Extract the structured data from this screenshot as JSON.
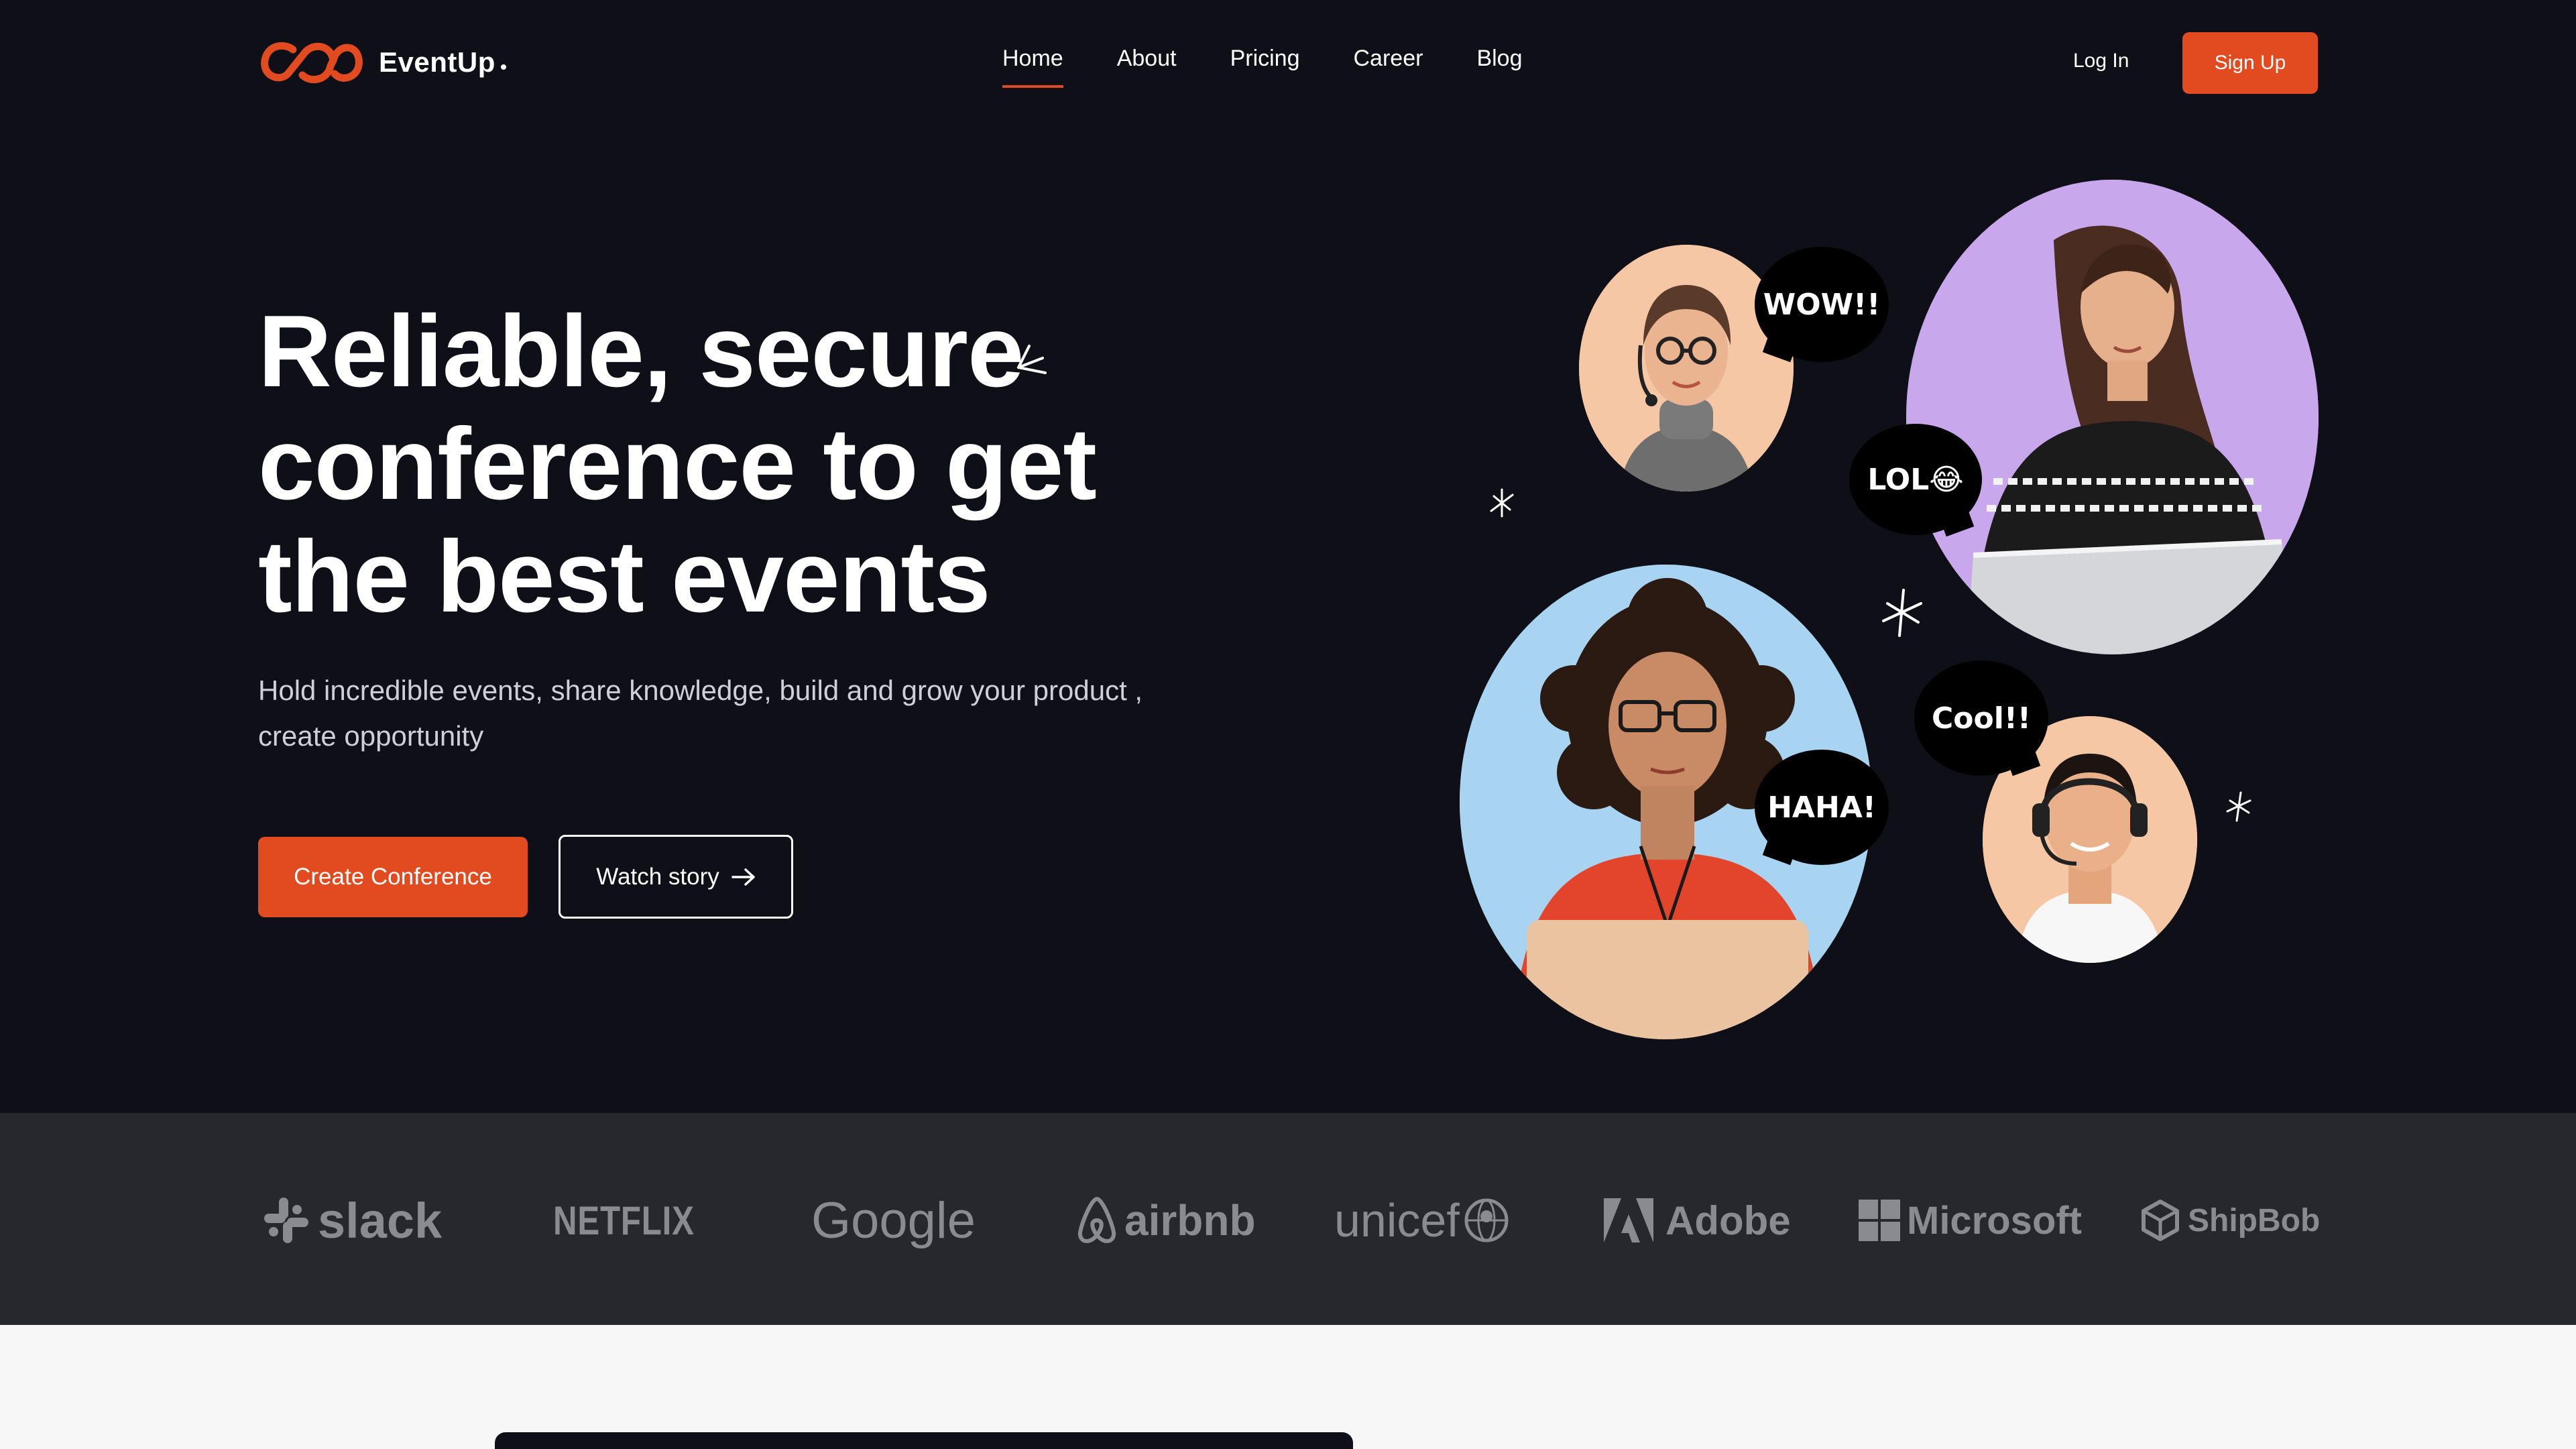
{
  "header": {
    "brand": "EventUp",
    "nav": [
      {
        "label": "Home",
        "active": true
      },
      {
        "label": "About"
      },
      {
        "label": "Pricing"
      },
      {
        "label": "Career"
      },
      {
        "label": "Blog"
      }
    ],
    "login_label": "Log In",
    "signup_label": "Sign Up"
  },
  "hero": {
    "title_line1": "Reliable, secure",
    "title_line2": "conference to get",
    "title_line3": "the best events",
    "subtitle_line1": "Hold incredible events, share knowledge, build and grow your product ,",
    "subtitle_line2": "create opportunity",
    "primary_button": "Create Conference",
    "secondary_button": "Watch story"
  },
  "bubbles": {
    "wow": "WOW!!",
    "lol": "LOL😂",
    "haha": "HAHA!",
    "cool": "Cool!!"
  },
  "brands": [
    "slack",
    "NETFLIX",
    "Google",
    "airbnb",
    "unicef",
    "Adobe",
    "Microsoft",
    "ShipBob"
  ],
  "colors": {
    "background": "#0f1017",
    "accent": "#e24a1f",
    "brand_strip": "#27282d",
    "brand_logo": "#8a8b90"
  }
}
